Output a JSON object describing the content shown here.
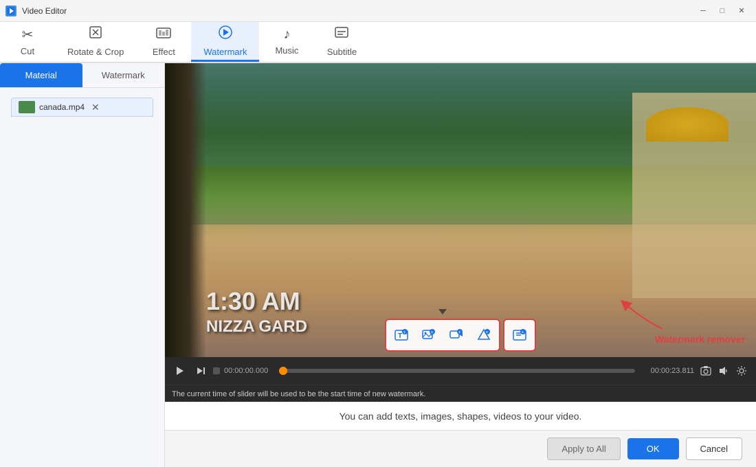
{
  "app": {
    "title": "Video Editor",
    "icon": "🎬"
  },
  "titlebar": {
    "title": "Video Editor",
    "minimize_label": "─",
    "maximize_label": "□",
    "close_label": "✕"
  },
  "file_tab": {
    "filename": "canada.mp4",
    "close_icon": "✕"
  },
  "tabs": [
    {
      "id": "cut",
      "label": "Cut",
      "icon": "✂"
    },
    {
      "id": "rotate",
      "label": "Rotate & Crop",
      "icon": "↻"
    },
    {
      "id": "effect",
      "label": "Effect",
      "icon": "🎞"
    },
    {
      "id": "watermark",
      "label": "Watermark",
      "icon": "🎬",
      "active": true
    },
    {
      "id": "music",
      "label": "Music",
      "icon": "♪"
    },
    {
      "id": "subtitle",
      "label": "Subtitle",
      "icon": "▤"
    }
  ],
  "left_panel": {
    "tab_material": "Material",
    "tab_watermark": "Watermark"
  },
  "video": {
    "overlay_text1": "1:30 AM",
    "overlay_text2": "NIZZA GARD"
  },
  "watermark_buttons": {
    "add_text_tooltip": "Add Text",
    "add_image_tooltip": "Add Image",
    "add_video_tooltip": "Add Video",
    "add_shape_tooltip": "Add Shape",
    "remove_tooltip": "Watermark Remover",
    "remover_label": "Watermark remover"
  },
  "timeline": {
    "play_icon": "▶",
    "step_icon": "⏭",
    "time_start": "00:00:00.000",
    "time_end": "00:00:23.811",
    "message": "The current time of slider will be used to be the start time of new watermark.",
    "camera_icon": "📷",
    "volume_icon": "🔊",
    "settings_icon": "⚙"
  },
  "info_text": "You can add texts, images, shapes, videos to your video.",
  "buttons": {
    "apply_to_all": "Apply to All",
    "ok": "OK",
    "cancel": "Cancel"
  }
}
